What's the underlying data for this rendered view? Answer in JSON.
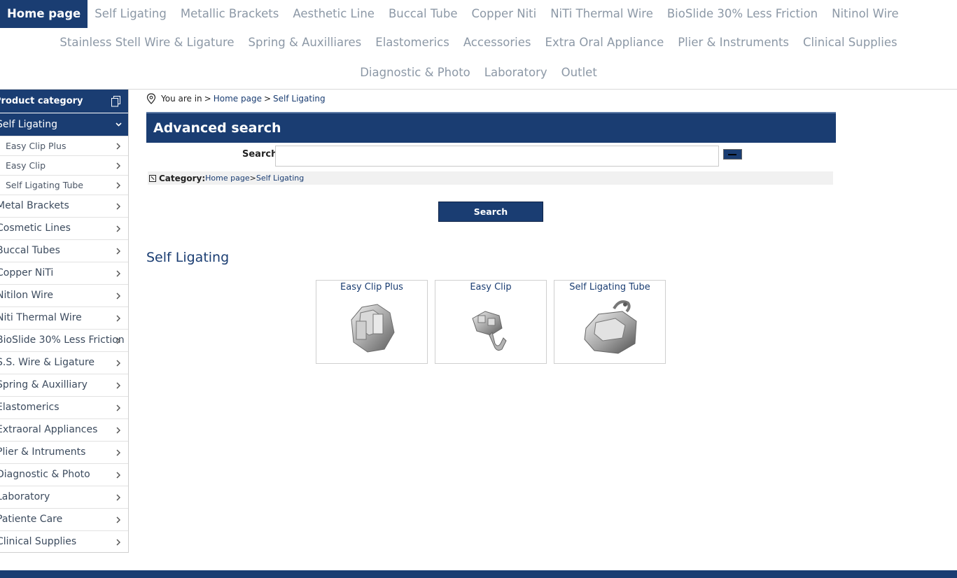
{
  "topnav": {
    "row1": [
      "Home page",
      "Self Ligating",
      "Metallic Brackets",
      "Aesthetic Line",
      "Buccal Tube",
      "Copper Niti",
      "NiTi Thermal Wire",
      "BioSlide 30% Less Friction",
      "Nitinol Wire"
    ],
    "row2": [
      "Stainless Stell Wire & Ligature",
      "Spring & Auxilliares",
      "Elastomerics",
      "Accessories",
      "Extra Oral Appliance",
      "Plier & Instruments",
      "Clinical Supplies"
    ],
    "row3": [
      "Diagnostic & Photo",
      "Laboratory",
      "Outlet"
    ]
  },
  "sidebar": {
    "header": "Product category",
    "open_item": "Self Ligating",
    "sub_items": [
      "Easy Clip Plus",
      "Easy Clip",
      "Self Ligating Tube"
    ],
    "items": [
      "Metal Brackets",
      "Cosmetic Lines",
      "Buccal Tubes",
      "Copper NiTi",
      "Nitilon Wire",
      "Niti Thermal Wire",
      "BioSlide 30% Less Friction",
      "S.S. Wire & Ligature",
      "Spring & Auxilliary",
      "Elastomerics",
      "Extraoral Appliances",
      "Plier & Intruments",
      "Diagnostic & Photo",
      "Laboratory",
      "Patiente Care",
      "Clinical Supplies"
    ]
  },
  "breadcrumb": {
    "prefix": "You are in",
    "sep": ">",
    "home": "Home page",
    "current": "Self Ligating"
  },
  "advanced_search": {
    "title": "Advanced search",
    "search_label": "Search",
    "search_value": "",
    "category_label": "Category:",
    "category_home": "Home page",
    "category_sep": ">",
    "category_current": "Self Ligating",
    "button_label": "Search"
  },
  "section": {
    "title": "Self Ligating",
    "cards": [
      "Easy Clip Plus",
      "Easy Clip",
      "Self Ligating Tube"
    ]
  },
  "colors": {
    "brand_navy": "#1a3d72",
    "nav_text": "#8c98a6"
  }
}
